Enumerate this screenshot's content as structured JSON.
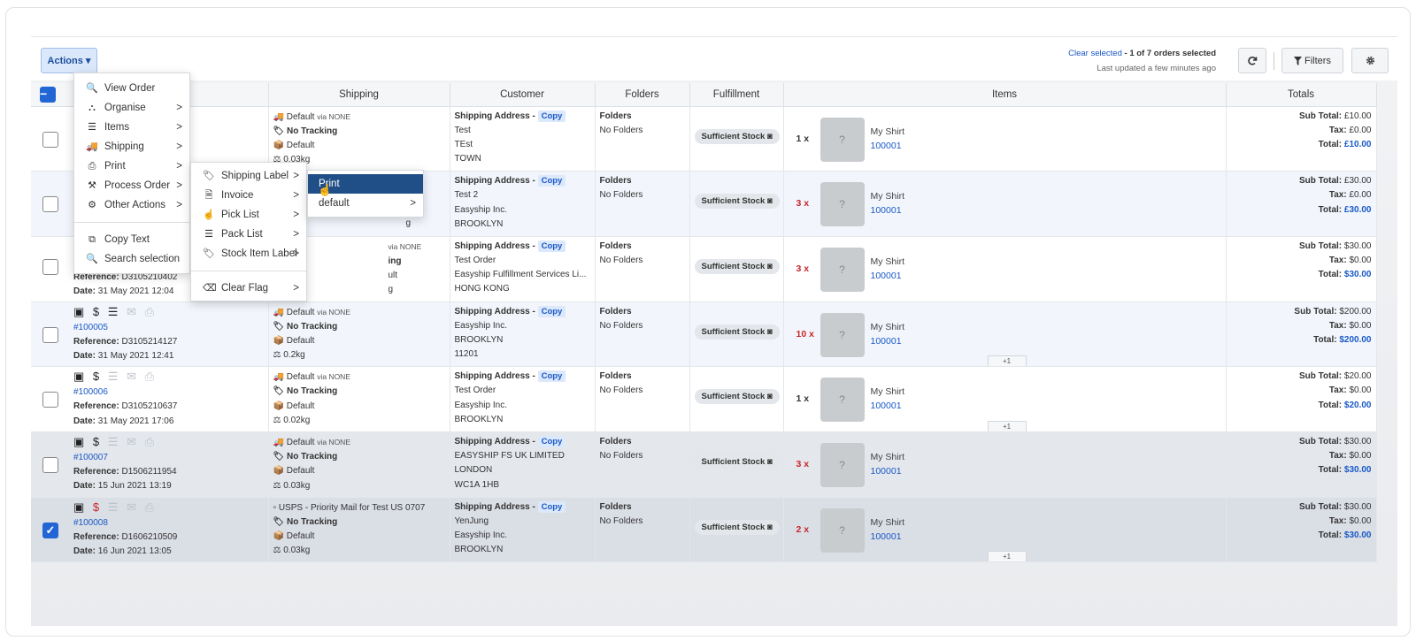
{
  "toolbar": {
    "actions_label": "Actions ▾",
    "clear_selected": "Clear selected",
    "selection_status": " - 1 of 7 orders selected",
    "last_updated": "Last updated a few minutes ago",
    "filters_label": "Filters",
    "refresh_icon": "refresh-icon",
    "gear_icon": "gear-icon"
  },
  "columns": [
    "",
    "Shipping",
    "Customer",
    "Folders",
    "Fulfillment",
    "Items",
    "Totals"
  ],
  "rows": [
    {
      "order_icons": "▣$☰✉⎙",
      "order_link": "",
      "reference": "",
      "date": "",
      "ship_method": "Default",
      "ship_via": "via NONE",
      "tracking": "No Tracking",
      "package": "Default",
      "weight": "0.03kg",
      "addr_label": "Shipping Address -",
      "addr_lines": [
        "Test",
        "TEst",
        "TOWN"
      ],
      "folders_label": "Folders",
      "folders_value": "No Folders",
      "stock": "Sufficient Stock",
      "qty": "1 x",
      "qty_red": false,
      "item_name": "My Shirt",
      "item_sku": "100001",
      "more": "",
      "sub_total": "£10.00",
      "tax": "£0.00",
      "total": "£10.00",
      "checked": false
    },
    {
      "order_icons": "",
      "order_link": "",
      "reference": "",
      "date": "",
      "ship_method": "",
      "ship_via": "",
      "tracking": "",
      "package": "",
      "weight": "0.03kg",
      "addr_label": "Shipping Address -",
      "addr_lines": [
        "Test 2",
        "Easyship Inc.",
        "BROOKLYN"
      ],
      "folders_label": "Folders",
      "folders_value": "No Folders",
      "stock": "Sufficient Stock",
      "qty": "3 x",
      "qty_red": true,
      "item_name": "My Shirt",
      "item_sku": "100001",
      "more": "",
      "sub_total": "£30.00",
      "tax": "£0.00",
      "total": "£30.00",
      "checked": false
    },
    {
      "order_icons": "",
      "order_link": "",
      "reference": "D3105210402",
      "date": "31 May 2021 12:04",
      "ship_method": "Default",
      "ship_via": "via NONE",
      "tracking": "No Tracking",
      "package": "Default",
      "weight": "0.03kg",
      "addr_label": "Shipping Address -",
      "addr_lines": [
        "Test Order",
        "Easyship Fulfillment Services Li...",
        "HONG KONG"
      ],
      "folders_label": "Folders",
      "folders_value": "No Folders",
      "stock": "Sufficient Stock",
      "qty": "3 x",
      "qty_red": true,
      "item_name": "My Shirt",
      "item_sku": "100001",
      "more": "",
      "sub_total": "$30.00",
      "tax": "$0.00",
      "total": "$30.00",
      "checked": false
    },
    {
      "order_icons": "",
      "order_link": "#100005",
      "reference": "D3105214127",
      "date": "31 May 2021 12:41",
      "ship_method": "Default",
      "ship_via": "via NONE",
      "tracking": "No Tracking",
      "package": "Default",
      "weight": "0.2kg",
      "addr_label": "Shipping Address -",
      "addr_lines": [
        "Easyship Inc.",
        "BROOKLYN",
        "11201"
      ],
      "folders_label": "Folders",
      "folders_value": "No Folders",
      "stock": "Sufficient Stock",
      "qty": "10 x",
      "qty_red": true,
      "item_name": "My Shirt",
      "item_sku": "100001",
      "more": "+1",
      "sub_total": "$200.00",
      "tax": "$0.00",
      "total": "$200.00",
      "checked": false
    },
    {
      "order_icons": "",
      "order_link": "#100006",
      "reference": "D3105210637",
      "date": "31 May 2021 17:06",
      "ship_method": "Default",
      "ship_via": "via NONE",
      "tracking": "No Tracking",
      "package": "Default",
      "weight": "0.02kg",
      "addr_label": "Shipping Address -",
      "addr_lines": [
        "Test Order",
        "Easyship Inc.",
        "BROOKLYN"
      ],
      "folders_label": "Folders",
      "folders_value": "No Folders",
      "stock": "Sufficient Stock",
      "qty": "1 x",
      "qty_red": false,
      "item_name": "My Shirt",
      "item_sku": "100001",
      "more": "+1",
      "sub_total": "$20.00",
      "tax": "$0.00",
      "total": "$20.00",
      "checked": false
    },
    {
      "order_icons": "",
      "order_link": "#100007",
      "reference": "D1506211954",
      "date": "15 Jun 2021 13:19",
      "ship_method": "Default",
      "ship_via": "via NONE",
      "tracking": "No Tracking",
      "package": "Default",
      "weight": "0.03kg",
      "addr_label": "Shipping Address -",
      "addr_lines": [
        "EASYSHIP FS UK LIMITED",
        "LONDON",
        "WC1A 1HB"
      ],
      "folders_label": "Folders",
      "folders_value": "No Folders",
      "stock": "Sufficient Stock",
      "qty": "3 x",
      "qty_red": true,
      "item_name": "My Shirt",
      "item_sku": "100001",
      "more": "",
      "sub_total": "$30.00",
      "tax": "$0.00",
      "total": "$30.00",
      "checked": false
    },
    {
      "order_icons": "",
      "order_link": "#100008",
      "reference": "D1606210509",
      "date": "16 Jun 2021 13:05",
      "ship_method": "USPS - Priority Mail for Test US 0707",
      "ship_via": "",
      "tracking": "No Tracking",
      "package": "Default",
      "weight": "0.03kg",
      "addr_label": "Shipping Address -",
      "addr_lines": [
        "YenJung",
        "Easyship Inc.",
        "BROOKLYN"
      ],
      "folders_label": "Folders",
      "folders_value": "No Folders",
      "stock": "Sufficient Stock",
      "qty": "2 x",
      "qty_red": true,
      "item_name": "My Shirt",
      "item_sku": "100001",
      "more": "+1",
      "sub_total": "$30.00",
      "tax": "$0.00",
      "total": "$30.00",
      "checked": true
    }
  ],
  "labels": {
    "reference": "Reference:",
    "date": "Date:",
    "copy": "Copy",
    "sub_total": "Sub Total:",
    "tax": "Tax:",
    "total": "Total:"
  },
  "menus": {
    "actions": [
      {
        "label": "View Order",
        "icon": "search-icon",
        "sub": false
      },
      {
        "label": "Organise",
        "icon": "sitemap-icon",
        "sub": true
      },
      {
        "label": "Items",
        "icon": "list-icon",
        "sub": true
      },
      {
        "label": "Shipping",
        "icon": "truck-icon",
        "sub": true
      },
      {
        "label": "Print",
        "icon": "printer-icon",
        "sub": true
      },
      {
        "label": "Process Order",
        "icon": "gavel-icon",
        "sub": true
      },
      {
        "label": "Other Actions",
        "icon": "gear-icon",
        "sub": true
      },
      {
        "label": "Copy Text",
        "icon": "copy-icon",
        "sub": false
      },
      {
        "label": "Search selection",
        "icon": "search-icon",
        "sub": false
      }
    ],
    "print": [
      {
        "label": "Shipping Label",
        "icon": "tag-icon"
      },
      {
        "label": "Invoice",
        "icon": "invoice-icon"
      },
      {
        "label": "Pick List",
        "icon": "hand-icon"
      },
      {
        "label": "Pack List",
        "icon": "list-icon"
      },
      {
        "label": "Stock Item Label",
        "icon": "tag-icon"
      },
      {
        "label": "Clear Flag",
        "icon": "eraser-icon"
      }
    ],
    "shipping_label": [
      {
        "label": "Print",
        "highlighted": true,
        "sub": false
      },
      {
        "label": "default",
        "highlighted": false,
        "sub": true
      }
    ],
    "arrow": ">"
  }
}
